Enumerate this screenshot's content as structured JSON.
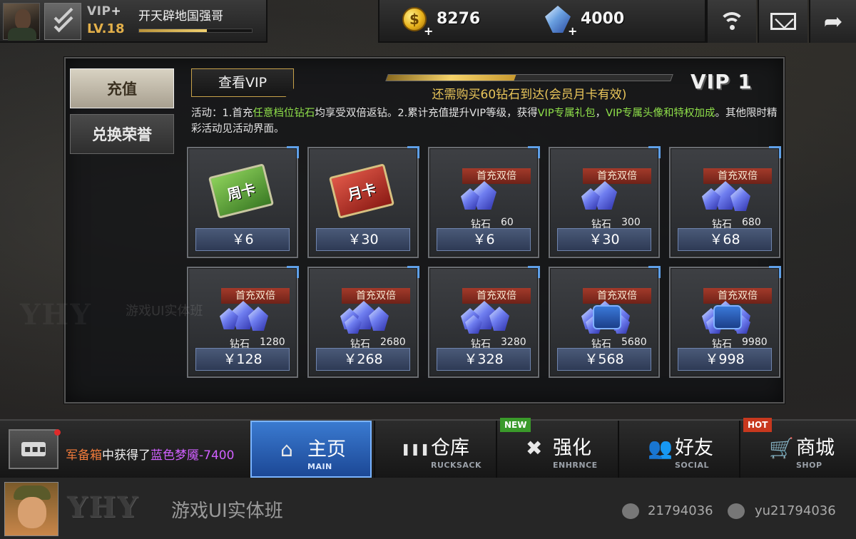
{
  "player": {
    "vip_tag": "VIP",
    "vip_plus": "+",
    "level": "LV.18",
    "name": "开天辟地国强哥",
    "exp_progress": 0.6
  },
  "currency": {
    "gold": "8276",
    "diamond": "4000",
    "plus": "+"
  },
  "tabs": {
    "recharge": "充值",
    "exchange": "兑换荣誉"
  },
  "vip": {
    "button_label": "查看VIP",
    "need_text": "还需购买60钻石到达(会员月卡有效)",
    "level": "VIP 1",
    "progress": 0.45
  },
  "activity": {
    "p1": "活动：1.首充",
    "h1": "任意档位钻石",
    "p2": "均享受双倍返钻。2.累计充值提升VIP等级，获得",
    "h2": "VIP专属礼包",
    "p3": "，",
    "h3": "VIP专属头像和特权加成",
    "p4": "。其他限时精彩活动见活动界面。"
  },
  "ribbon_text": "首充双倍",
  "diamond_label": "钻石",
  "products": [
    {
      "kind": "week",
      "art_text": "周卡",
      "price": "￥6"
    },
    {
      "kind": "month",
      "art_text": "月卡",
      "price": "￥30"
    },
    {
      "kind": "gem",
      "amount": "60",
      "price": "￥6"
    },
    {
      "kind": "gem",
      "amount": "300",
      "price": "￥30"
    },
    {
      "kind": "gem",
      "amount": "680",
      "price": "￥68"
    },
    {
      "kind": "gem",
      "amount": "1280",
      "price": "￥128"
    },
    {
      "kind": "gem",
      "amount": "2680",
      "price": "￥268"
    },
    {
      "kind": "gem",
      "amount": "3280",
      "price": "￥328"
    },
    {
      "kind": "gem",
      "amount": "5680",
      "price": "￥568"
    },
    {
      "kind": "gem",
      "amount": "9980",
      "price": "￥998"
    }
  ],
  "ticker": {
    "part1": "军备箱",
    "part2": "中获得了",
    "part3": "蓝色梦魇-7400"
  },
  "nav": [
    {
      "label": "主页",
      "sub": "MAIN",
      "icon": "home-icon",
      "glyph": "⌂"
    },
    {
      "label": "仓库",
      "sub": "RUCKSACK",
      "icon": "ammo-icon",
      "glyph": "❚❚❚",
      "flag": ""
    },
    {
      "label": "强化",
      "sub": "ENHRNCE",
      "icon": "tools-icon",
      "glyph": "✖",
      "flag": "NEW"
    },
    {
      "label": "好友",
      "sub": "SOCIAL",
      "icon": "friends-icon",
      "glyph": "👥",
      "flag": ""
    },
    {
      "label": "商城",
      "sub": "SHOP",
      "icon": "cart-icon",
      "glyph": "🛒",
      "flag": "HOT"
    }
  ],
  "footer": {
    "logo": "YHY",
    "brand": "游戏UI实体班",
    "qq": "21794036",
    "wechat": "yu21794036"
  },
  "watermark": {
    "logo": "YHY",
    "text": "游戏UI实体班"
  }
}
